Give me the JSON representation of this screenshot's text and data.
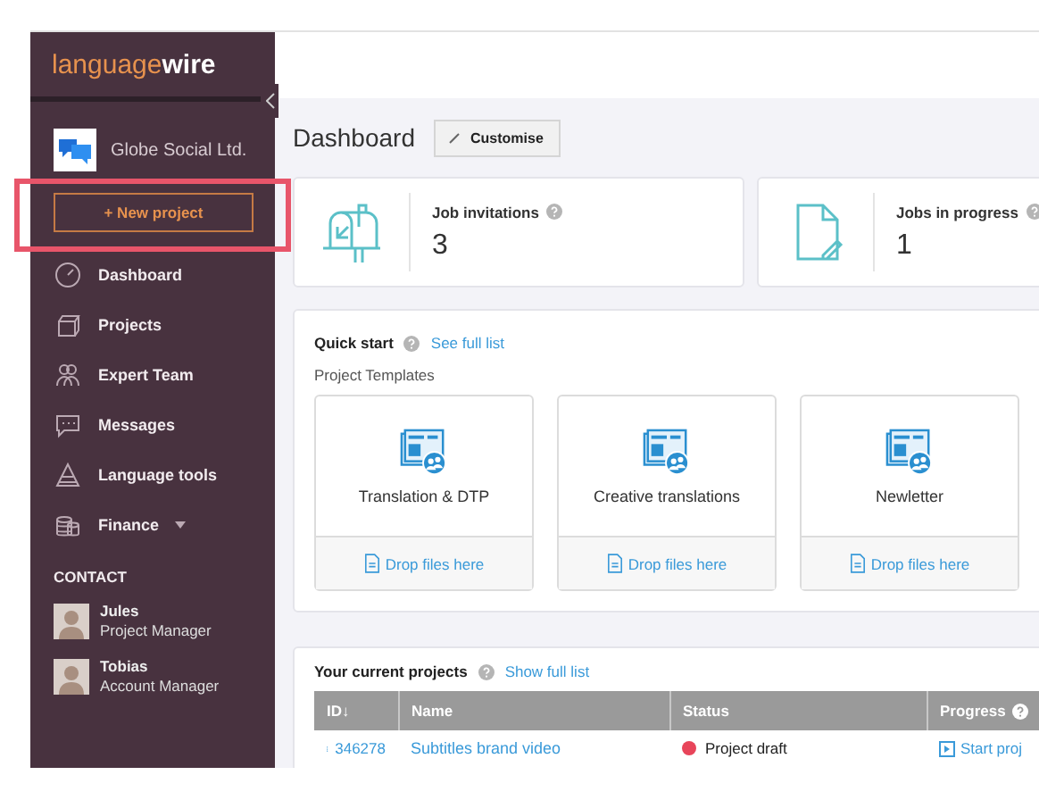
{
  "logo": {
    "light": "language",
    "bold": "wire"
  },
  "company": {
    "name": "Globe Social Ltd."
  },
  "new_project_button": {
    "label": "+ New project",
    "highlighted": true
  },
  "nav": [
    {
      "label": "Dashboard",
      "kind": "gauge",
      "dropdown": false
    },
    {
      "label": "Projects",
      "kind": "box",
      "dropdown": false
    },
    {
      "label": "Expert Team",
      "kind": "team",
      "dropdown": false
    },
    {
      "label": "Messages",
      "kind": "chat",
      "dropdown": false
    },
    {
      "label": "Language tools",
      "kind": "letter",
      "dropdown": false
    },
    {
      "label": "Finance",
      "kind": "coins",
      "dropdown": true
    }
  ],
  "contact": {
    "heading": "CONTACT",
    "people": [
      {
        "name": "Jules",
        "role": "Project Manager"
      },
      {
        "name": "Tobias",
        "role": "Account Manager"
      }
    ]
  },
  "page_title": "Dashboard",
  "customise_button": "Customise",
  "stats": [
    {
      "label": "Job invitations",
      "value": "3",
      "kind": "mailbox"
    },
    {
      "label": "Jobs in progress",
      "value": "1",
      "kind": "document"
    }
  ],
  "quick_start": {
    "title": "Quick start",
    "link": "See full list",
    "subtitle": "Project Templates",
    "templates": [
      {
        "name": "Translation & DTP",
        "drop": "Drop files here"
      },
      {
        "name": "Creative translations",
        "drop": "Drop files here"
      },
      {
        "name": "Newletter",
        "drop": "Drop files here"
      }
    ]
  },
  "projects": {
    "title": "Your current projects",
    "link": "Show full list",
    "columns": [
      {
        "label": "ID↓",
        "help": false
      },
      {
        "label": "Name",
        "help": false
      },
      {
        "label": "Status",
        "help": false
      },
      {
        "label": "Progress",
        "help": true
      }
    ],
    "rows": [
      {
        "id": "346278",
        "name": "Subtitles brand video",
        "status": "Project draft",
        "color": "#e8455a",
        "action": "Start proj"
      }
    ]
  }
}
